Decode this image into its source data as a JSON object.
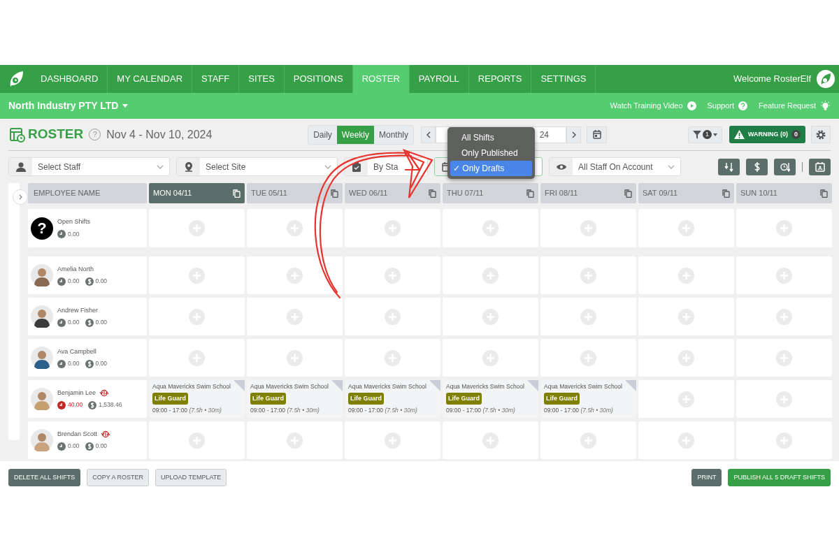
{
  "nav": {
    "items": [
      {
        "label": "DASHBOARD",
        "selected": false
      },
      {
        "label": "MY CALENDAR",
        "selected": false
      },
      {
        "label": "STAFF",
        "selected": false
      },
      {
        "label": "SITES",
        "selected": false
      },
      {
        "label": "POSITIONS",
        "selected": false
      },
      {
        "label": "ROSTER",
        "selected": true
      },
      {
        "label": "PAYROLL",
        "selected": false
      },
      {
        "label": "REPORTS",
        "selected": false
      },
      {
        "label": "SETTINGS",
        "selected": false
      }
    ],
    "welcome": "Welcome RosterElf"
  },
  "subbar": {
    "company": "North Industry PTY LTD",
    "links": [
      {
        "label": "Watch Training Video",
        "kind": "play"
      },
      {
        "label": "Support",
        "kind": "help"
      },
      {
        "label": "Feature Request",
        "kind": "bulb"
      }
    ]
  },
  "header": {
    "title": "ROSTER",
    "help": "?",
    "date_range": "Nov 4 - Nov 10, 2024",
    "views": [
      {
        "label": "Daily",
        "selected": false
      },
      {
        "label": "Weekly",
        "selected": true
      },
      {
        "label": "Monthly",
        "selected": false
      }
    ],
    "date_field": "24",
    "filter_count": "1",
    "warning": "WARNING (0)",
    "warning_count": "0"
  },
  "dropdown": {
    "check": "✓",
    "options": [
      {
        "label": "All Shifts",
        "selected": false
      },
      {
        "label": "Only Published",
        "selected": false
      },
      {
        "label": "Only Drafts",
        "selected": true
      }
    ]
  },
  "filters": {
    "staff": {
      "placeholder": "Select Staff"
    },
    "site": {
      "placeholder": "Select Site"
    },
    "status": "By Sta",
    "staff_view": "All Staff On Account"
  },
  "grid": {
    "employee_header": "EMPLOYEE NAME",
    "columns": [
      {
        "label": "MON 04/11",
        "selected": true
      },
      {
        "label": "TUE 05/11",
        "selected": false
      },
      {
        "label": "WED 06/11",
        "selected": false
      },
      {
        "label": "THU 07/11",
        "selected": false
      },
      {
        "label": "FRI 08/11",
        "selected": false
      },
      {
        "label": "SAT 09/11",
        "selected": false
      },
      {
        "label": "SUN 10/11",
        "selected": false
      }
    ],
    "rows": [
      {
        "kind": "open",
        "icon": "?",
        "name": "Open Shifts",
        "hours": "0.00",
        "overtime": false,
        "swap": false,
        "shifts": [
          {
            "kind": "empty"
          },
          {
            "kind": "empty"
          },
          {
            "kind": "empty"
          },
          {
            "kind": "empty"
          },
          {
            "kind": "empty"
          },
          {
            "kind": "empty"
          },
          {
            "kind": "empty"
          }
        ]
      },
      {
        "kind": "staff",
        "name": "Amelia North",
        "hours": "0.00",
        "pay": "0.00",
        "overtime": false,
        "swap": false,
        "shifts": [
          {
            "kind": "empty"
          },
          {
            "kind": "empty"
          },
          {
            "kind": "empty"
          },
          {
            "kind": "empty"
          },
          {
            "kind": "empty"
          },
          {
            "kind": "empty"
          },
          {
            "kind": "empty"
          }
        ]
      },
      {
        "kind": "staff",
        "name": "Andrew Fisher",
        "hours": "0.00",
        "pay": "0.00",
        "overtime": false,
        "swap": false,
        "shifts": [
          {
            "kind": "empty"
          },
          {
            "kind": "empty"
          },
          {
            "kind": "empty"
          },
          {
            "kind": "empty"
          },
          {
            "kind": "empty"
          },
          {
            "kind": "empty"
          },
          {
            "kind": "empty"
          }
        ]
      },
      {
        "kind": "staff",
        "name": "Ava Campbell",
        "hours": "0.00",
        "pay": "0.00",
        "overtime": false,
        "swap": false,
        "shifts": [
          {
            "kind": "empty"
          },
          {
            "kind": "empty"
          },
          {
            "kind": "empty"
          },
          {
            "kind": "empty"
          },
          {
            "kind": "empty"
          },
          {
            "kind": "empty"
          },
          {
            "kind": "empty"
          }
        ]
      },
      {
        "kind": "staff",
        "name": "Benjamin Lee",
        "hours": "40.00",
        "pay": "1,538.46",
        "overtime": true,
        "swap": true,
        "shifts": [
          {
            "kind": "shift",
            "site": "Aqua Mavericks Swim School",
            "position": "Life Guard",
            "time": "09:00 - 17:00",
            "detail": "(7.5h • 30m)",
            "draft": true
          },
          {
            "kind": "shift",
            "site": "Aqua Mavericks Swim School",
            "position": "Life Guard",
            "time": "09:00 - 17:00",
            "detail": "(7.5h • 30m)",
            "draft": true
          },
          {
            "kind": "shift",
            "site": "Aqua Mavericks Swim School",
            "position": "Life Guard",
            "time": "09:00 - 17:00",
            "detail": "(7.5h • 30m)",
            "draft": true
          },
          {
            "kind": "shift",
            "site": "Aqua Mavericks Swim School",
            "position": "Life Guard",
            "time": "09:00 - 17:00",
            "detail": "(7.5h • 30m)",
            "draft": true
          },
          {
            "kind": "shift",
            "site": "Aqua Mavericks Swim School",
            "position": "Life Guard",
            "time": "09:00 - 17:00",
            "detail": "(7.5h • 30m)",
            "draft": true
          },
          {
            "kind": "empty"
          },
          {
            "kind": "empty"
          }
        ]
      },
      {
        "kind": "staff",
        "name": "Brendan Scott",
        "hours": "0.00",
        "pay": "0.00",
        "overtime": false,
        "swap": true,
        "shifts": [
          {
            "kind": "empty"
          },
          {
            "kind": "empty"
          },
          {
            "kind": "empty"
          },
          {
            "kind": "empty"
          },
          {
            "kind": "empty"
          },
          {
            "kind": "empty"
          },
          {
            "kind": "empty"
          }
        ]
      }
    ]
  },
  "footer": {
    "left": [
      {
        "label": "DELETE ALL SHIFTS",
        "kind": "dark"
      },
      {
        "label": "COPY A ROSTER",
        "kind": "light"
      },
      {
        "label": "UPLOAD TEMPLATE",
        "kind": "light"
      }
    ],
    "right": [
      {
        "label": "PRINT",
        "kind": "dark"
      },
      {
        "label": "PUBLISH ALL 5 DRAFT SHIFTS",
        "kind": "green"
      }
    ]
  }
}
